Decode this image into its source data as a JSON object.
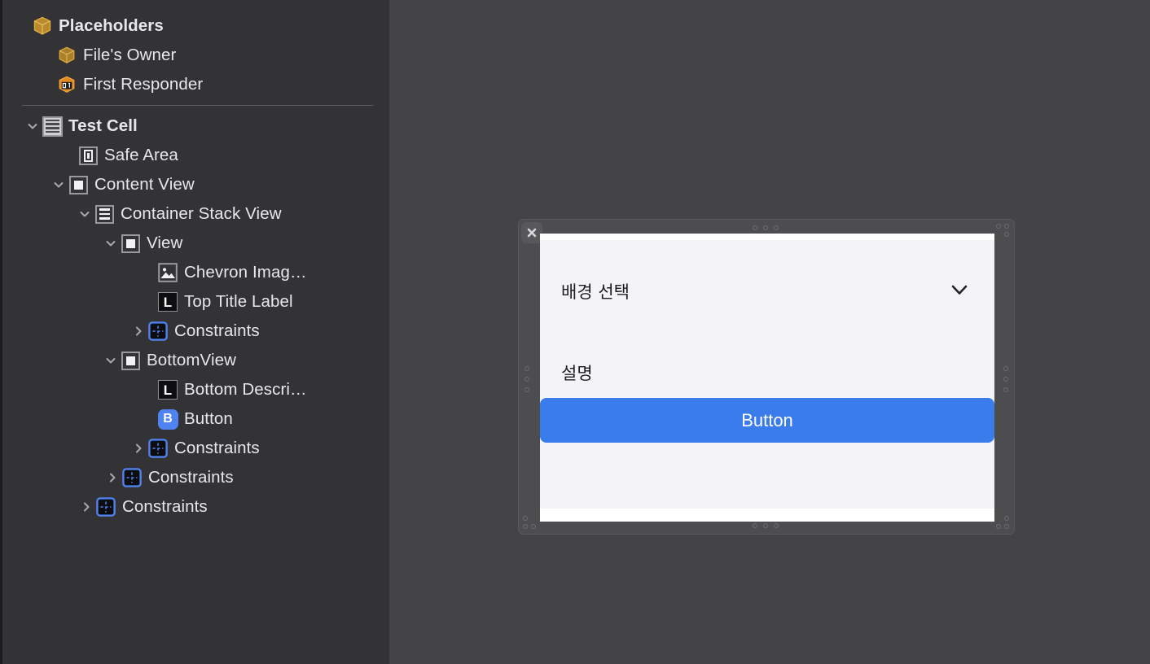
{
  "outline": {
    "placeholders": {
      "label": "Placeholders",
      "icon": "xib-placeholder-cube-icon",
      "children": [
        {
          "label": "File's Owner",
          "icon": "file-owner-cube-icon"
        },
        {
          "label": "First Responder",
          "icon": "first-responder-cube-icon"
        }
      ]
    },
    "scene": [
      {
        "label": "Test Cell",
        "icon": "table-view-cell-icon",
        "twisty": "expanded",
        "depth": 0
      },
      {
        "label": "Safe Area",
        "icon": "safe-area-icon",
        "twisty": "none",
        "depth": 1
      },
      {
        "label": "Content View",
        "icon": "view-icon",
        "twisty": "expanded",
        "depth": 1
      },
      {
        "label": "Container Stack View",
        "icon": "stack-view-icon",
        "twisty": "expanded",
        "depth": 2
      },
      {
        "label": "View",
        "icon": "view-icon",
        "twisty": "expanded",
        "depth": 3
      },
      {
        "label": "Chevron Imag…",
        "icon": "image-view-icon",
        "twisty": "none",
        "depth": 4
      },
      {
        "label": "Top Title Label",
        "icon": "label-icon",
        "twisty": "none",
        "depth": 4
      },
      {
        "label": "Constraints",
        "icon": "constraints-icon",
        "twisty": "collapsed",
        "depth": 4
      },
      {
        "label": "BottomView",
        "icon": "view-icon",
        "twisty": "expanded",
        "depth": 3
      },
      {
        "label": "Bottom Descri…",
        "icon": "label-icon",
        "twisty": "none",
        "depth": 4
      },
      {
        "label": "Button",
        "icon": "button-icon",
        "twisty": "none",
        "depth": 4
      },
      {
        "label": "Constraints",
        "icon": "constraints-icon",
        "twisty": "collapsed",
        "depth": 4
      },
      {
        "label": "Constraints",
        "icon": "constraints-icon",
        "twisty": "collapsed",
        "depth": 3
      },
      {
        "label": "Constraints",
        "icon": "constraints-icon",
        "twisty": "collapsed",
        "depth": 2
      }
    ]
  },
  "canvas": {
    "close_icon": "close-x-icon",
    "preview": {
      "top_title": "배경 선택",
      "chevron_icon": "chevron-down-icon",
      "bottom_description": "설명",
      "button_label": "Button"
    }
  },
  "colors": {
    "sidebar_bg": "#333335",
    "canvas_bg": "#444446",
    "selection_frame": "#4d4d4f",
    "accent_blue": "#3b7ced",
    "button_icon_blue": "#4f83f1",
    "constraint_blue": "#4f83f1",
    "placeholder_gold": "#c8952e",
    "first_responder_orange": "#e08a22",
    "cell_bg": "#f4f4f6",
    "text_light": "#e8e8ea",
    "text_dark": "#1d1d1f"
  }
}
